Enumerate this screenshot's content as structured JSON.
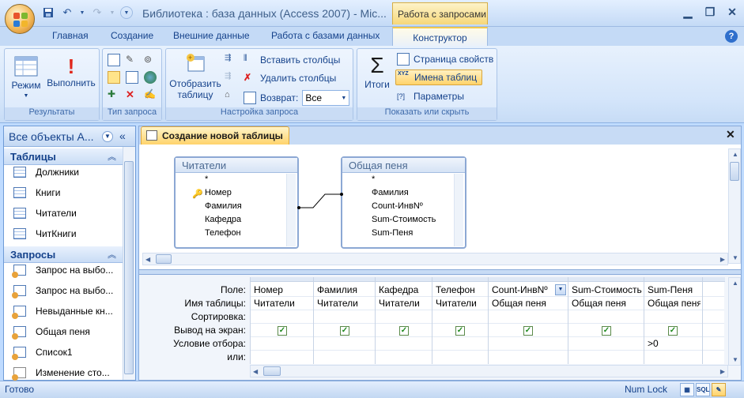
{
  "window": {
    "title": "Библиотека : база данных (Access 2007) - Mic...",
    "contextual_tab_group": "Работа с запросами"
  },
  "ribbon_tabs": [
    "Главная",
    "Создание",
    "Внешние данные",
    "Работа с базами данных",
    "Конструктор"
  ],
  "ribbon": {
    "results": {
      "label": "Результаты",
      "mode": "Режим",
      "run": "Выполнить"
    },
    "query_type": {
      "label": "Тип запроса"
    },
    "query_setup": {
      "label": "Настройка запроса",
      "show_table": "Отобразить таблицу",
      "insert_columns": "Вставить столбцы",
      "delete_columns": "Удалить столбцы",
      "return_label": "Возврат:",
      "return_value": "Все"
    },
    "show_hide": {
      "label": "Показать или скрыть",
      "totals": "Итоги",
      "property_sheet": "Страница свойств",
      "table_names": "Имена таблиц",
      "parameters": "Параметры"
    }
  },
  "nav_pane": {
    "title": "Все объекты А...",
    "sections": [
      {
        "title": "Таблицы",
        "items": [
          "Должники",
          "Книги",
          "Читатели",
          "ЧитКниги"
        ]
      },
      {
        "title": "Запросы",
        "items": [
          "Запрос на выбо...",
          "Запрос на выбо...",
          "Невыданные кн...",
          "Общая пеня",
          "Список1",
          "Изменение сто..."
        ]
      }
    ]
  },
  "document_tab": "Создание новой таблицы",
  "tables": [
    {
      "title": "Читатели",
      "fields": [
        "*",
        "Номер",
        "Фамилия",
        "Кафедра",
        "Телефон"
      ]
    },
    {
      "title": "Общая пеня",
      "fields": [
        "*",
        "Фамилия",
        "Count-ИнвNº",
        "Sum-Стоимость",
        "Sum-Пеня"
      ]
    }
  ],
  "grid": {
    "row_labels": [
      "Поле:",
      "Имя таблицы:",
      "Сортировка:",
      "Вывод на экран:",
      "Условие отбора:",
      "или:"
    ],
    "columns": [
      {
        "field": "Номер",
        "table": "Читатели",
        "show": true,
        "criteria": ""
      },
      {
        "field": "Фамилия",
        "table": "Читатели",
        "show": true,
        "criteria": ""
      },
      {
        "field": "Кафедра",
        "table": "Читатели",
        "show": true,
        "criteria": ""
      },
      {
        "field": "Телефон",
        "table": "Читатели",
        "show": true,
        "criteria": ""
      },
      {
        "field": "Count-ИнвNº",
        "table": "Общая пеня",
        "show": true,
        "criteria": ""
      },
      {
        "field": "Sum-Стоимость",
        "table": "Общая пеня",
        "show": true,
        "criteria": ""
      },
      {
        "field": "Sum-Пеня",
        "table": "Общая пеня",
        "show": true,
        "criteria": ">0"
      }
    ]
  },
  "status": {
    "left": "Готово",
    "numlock": "Num Lock"
  }
}
